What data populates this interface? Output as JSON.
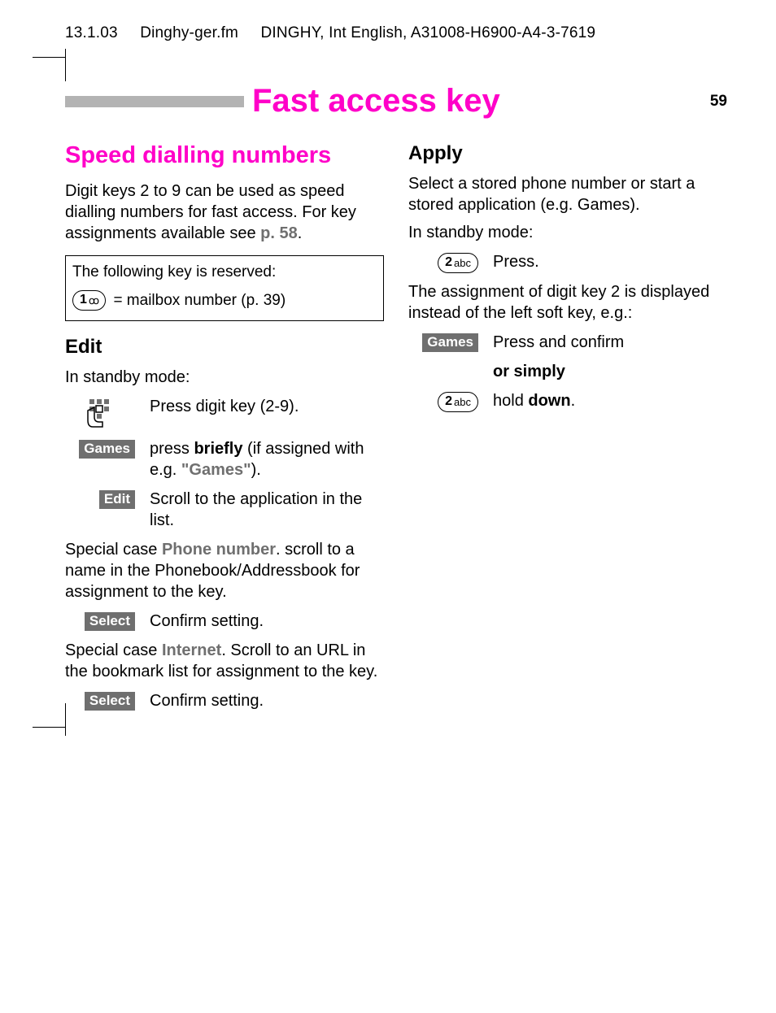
{
  "header": {
    "date": "13.1.03",
    "file": "Dinghy-ger.fm",
    "doc": "DINGHY, Int English, A31008-H6900-A4-3-7619"
  },
  "title": "Fast access key",
  "page_number": "59",
  "left": {
    "heading": "Speed dialling numbers",
    "intro_1": "Digit keys 2 to 9 can be used as speed dialling numbers for fast access. For key assignments available see ",
    "intro_ref": "p. 58",
    "intro_2": ".",
    "note_line1": "The following key is reserved:",
    "note_key_num": "1",
    "note_key_sym": "⏯",
    "note_text": " = mailbox number (p. 39)",
    "edit_heading": "Edit",
    "edit_standby": "In standby mode:",
    "edit_step1": "Press digit key (2-9).",
    "games_label": "Games",
    "edit_step2a": "press ",
    "edit_step2_bold": "briefly",
    "edit_step2b": " (if assigned with e.g. ",
    "edit_step2_grey": "\"Games\"",
    "edit_step2c": ").",
    "edit_softkey_label": "Edit",
    "edit_step3": "Scroll to the application in the list.",
    "special1a": "Special case ",
    "special1_grey": "Phone number",
    "special1b": ". scroll to a name in the Phonebook/Addressbook for assignment to the key.",
    "select_label": "Select",
    "confirm_text": "Confirm setting.",
    "special2a": "Special case ",
    "special2_grey": "Internet",
    "special2b": ". Scroll to an URL in the bookmark list for assignment to the key."
  },
  "right": {
    "apply_heading": "Apply",
    "apply_intro": "Select a stored phone number or start a stored application (e.g. Games).",
    "apply_standby": "In standby mode:",
    "key2_num": "2",
    "key2_abc": "abc",
    "press_text": "Press.",
    "apply_result": "The assignment of digit key 2 is displayed instead of the left soft key, e.g.:",
    "games_label": "Games",
    "press_confirm": "Press and confirm",
    "or_simply": "or simply",
    "hold_a": "hold ",
    "hold_bold": "down",
    "hold_b": "."
  }
}
